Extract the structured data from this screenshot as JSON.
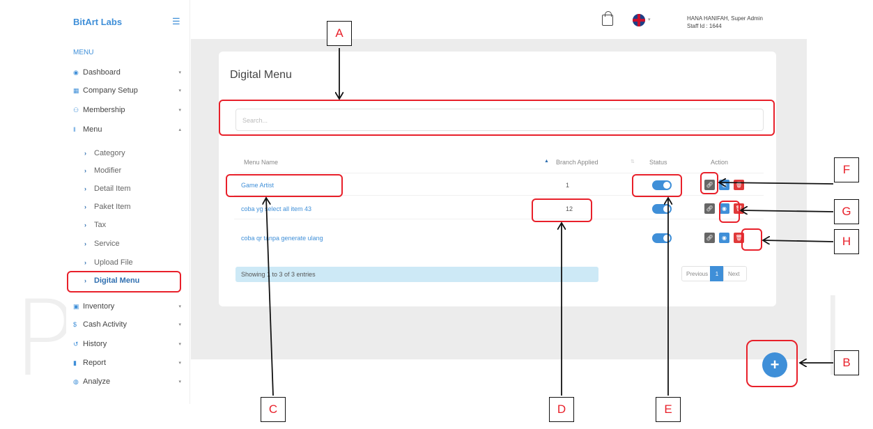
{
  "sidebar": {
    "brand": "BitArt Labs",
    "menu_title": "MENU",
    "items": [
      {
        "label": "Dashboard",
        "icon": "dashboard-icon",
        "glyph": "◉"
      },
      {
        "label": "Company Setup",
        "icon": "building-icon",
        "glyph": "▦"
      },
      {
        "label": "Membership",
        "icon": "users-icon",
        "glyph": "⚇"
      },
      {
        "label": "Menu",
        "icon": "utensils-icon",
        "glyph": "ǁ"
      }
    ],
    "sub_items": [
      {
        "label": "Category"
      },
      {
        "label": "Modifier"
      },
      {
        "label": "Detail Item"
      },
      {
        "label": "Paket Item"
      },
      {
        "label": "Tax"
      },
      {
        "label": "Service"
      },
      {
        "label": "Upload File"
      },
      {
        "label": "Digital Menu"
      }
    ],
    "items_after": [
      {
        "label": "Inventory",
        "icon": "inventory-icon",
        "glyph": "▣"
      },
      {
        "label": "Cash Activity",
        "icon": "dollar-icon",
        "glyph": "$"
      },
      {
        "label": "History",
        "icon": "history-icon",
        "glyph": "↺"
      },
      {
        "label": "Report",
        "icon": "report-icon",
        "glyph": "▮"
      },
      {
        "label": "Analyze",
        "icon": "analyze-icon",
        "glyph": "◍"
      }
    ]
  },
  "header": {
    "user_name": "HANA HANIFAH, Super Admin",
    "staff_id": "Staff Id : 1644"
  },
  "page": {
    "title": "Digital Menu",
    "search_placeholder": "Search...",
    "columns": {
      "menu_name": "Menu Name",
      "branch_applied": "Branch Applied",
      "status": "Status",
      "action": "Action"
    },
    "rows": [
      {
        "name": "Game Artist",
        "branch": "1",
        "status": true
      },
      {
        "name": "coba yg select all item 43",
        "branch": "12",
        "status": true
      },
      {
        "name": "coba qr tanpa generate ulang",
        "branch": "",
        "status": true
      }
    ],
    "info": "Showing 1 to 3 of 3 entries",
    "pagination": {
      "previous": "Previous",
      "current": "1",
      "next": "Next"
    }
  },
  "annotations": {
    "labels": [
      "A",
      "B",
      "C",
      "D",
      "E",
      "F",
      "G",
      "H"
    ],
    "accent": "#e8202a"
  },
  "colors": {
    "primary": "#3f8fd8",
    "danger": "#e03a3a",
    "content_bg": "#ececec"
  }
}
